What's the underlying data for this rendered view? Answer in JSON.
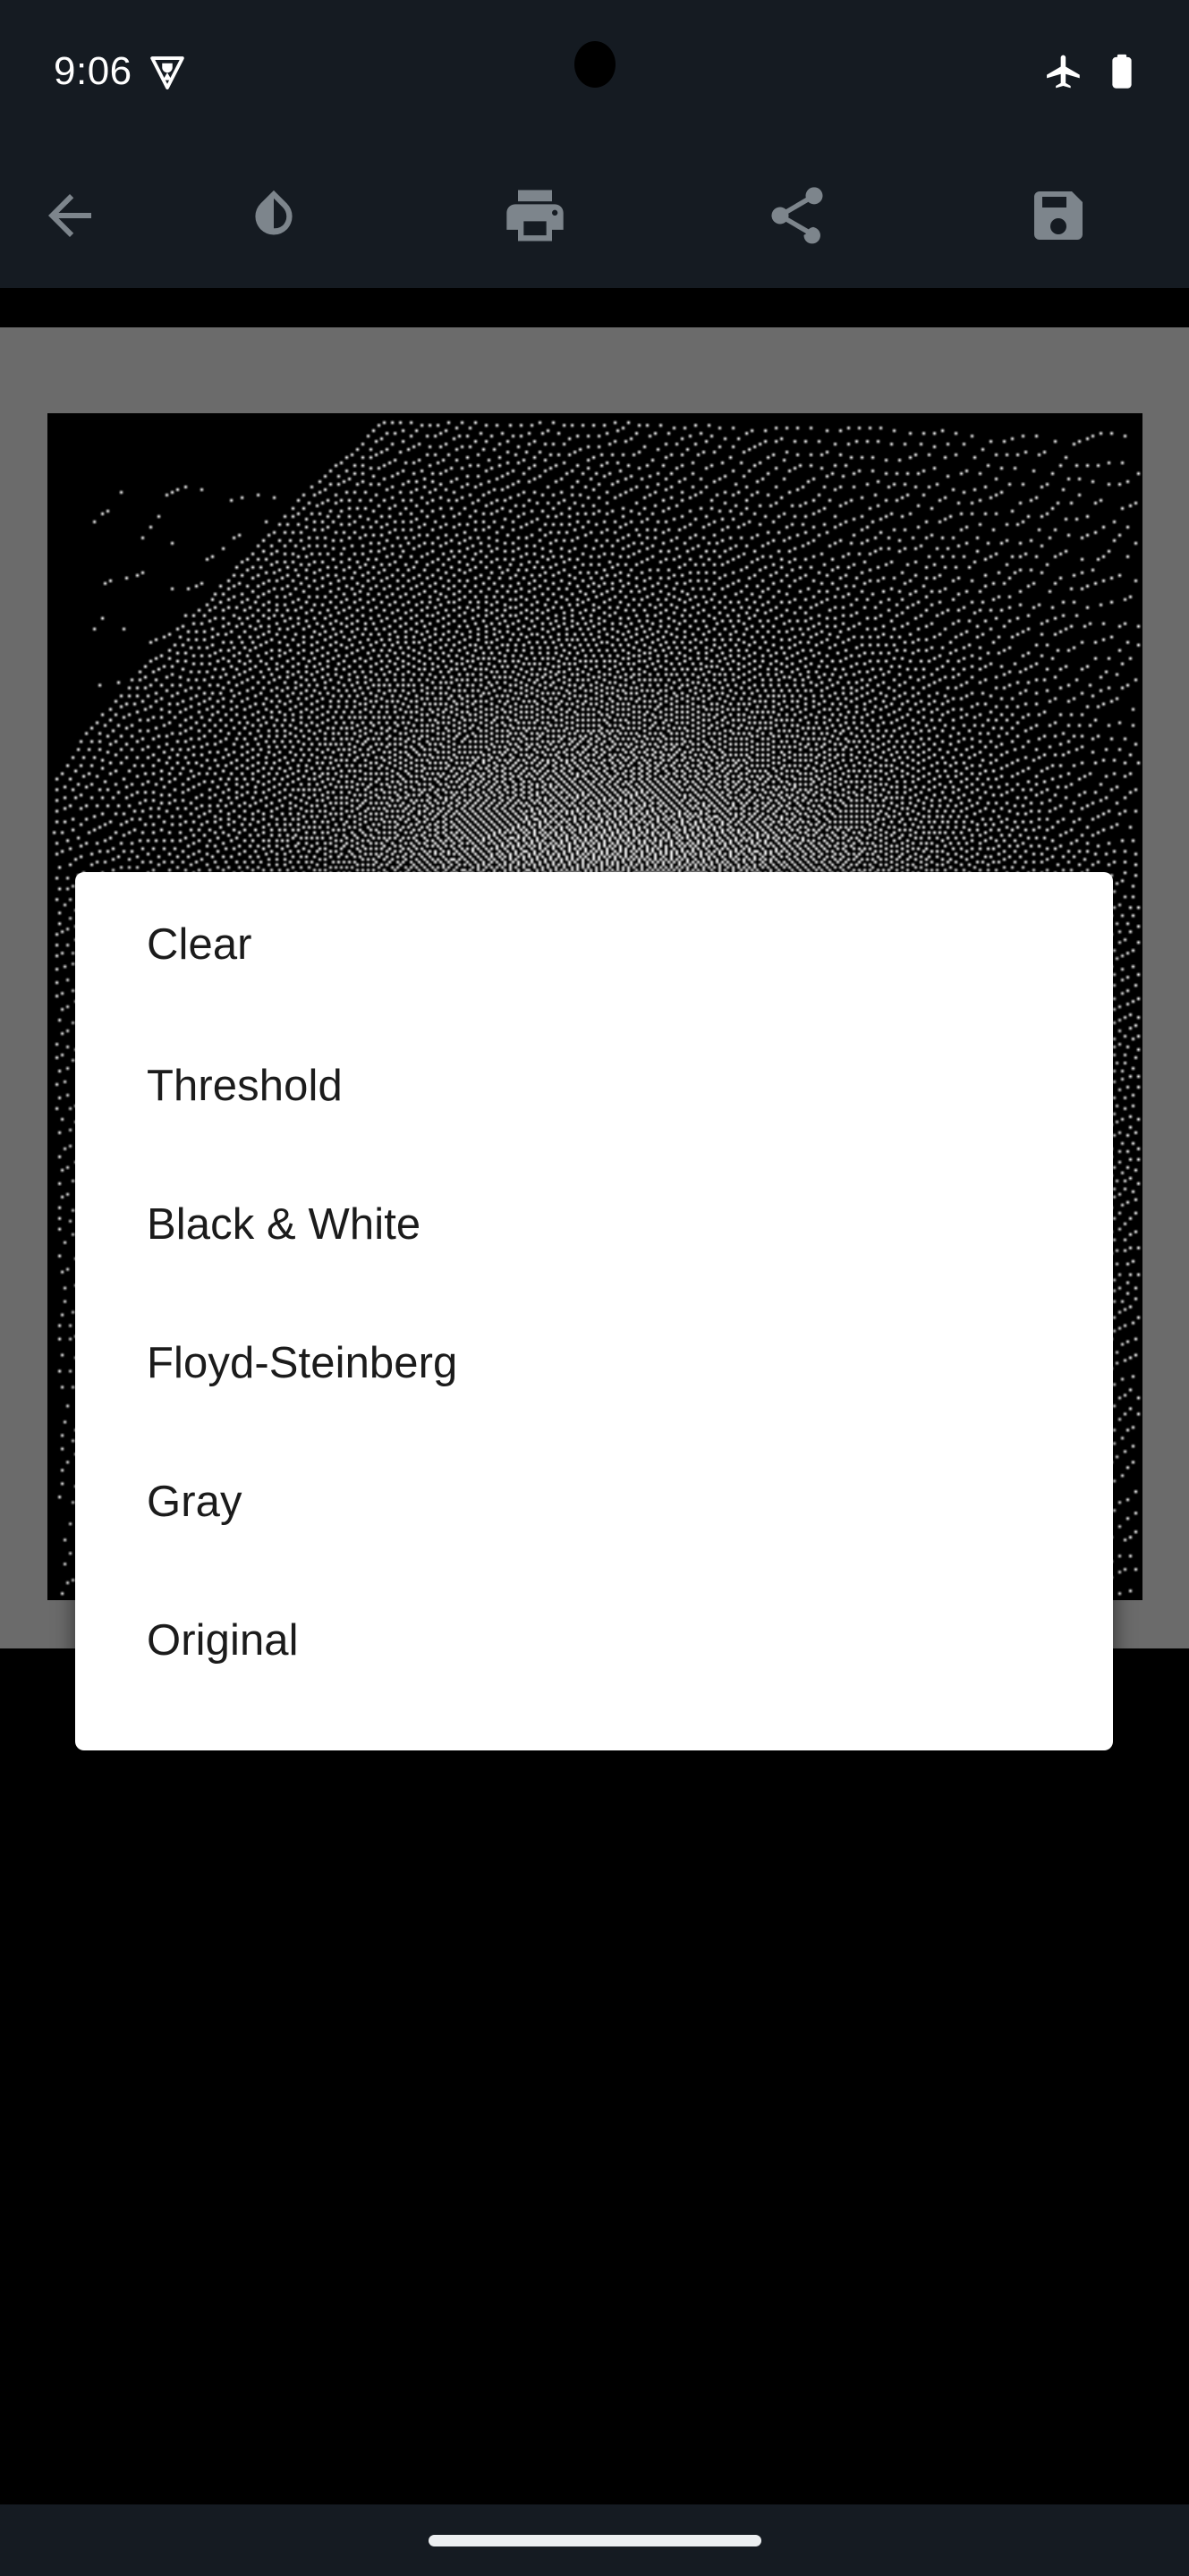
{
  "status_bar": {
    "time": "9:06",
    "icons": [
      {
        "name": "app-notification-icon",
        "glyph": "shield-badge"
      },
      {
        "name": "airplane-mode-icon",
        "glyph": "airplane"
      },
      {
        "name": "battery-icon",
        "glyph": "battery-full"
      }
    ],
    "camera_hole": "front-camera-cutout"
  },
  "toolbar": {
    "background_color": "#151b22",
    "icon_color": "#7d858c",
    "buttons": [
      {
        "name": "back-button",
        "icon": "arrow-left-icon",
        "label": "Back"
      },
      {
        "name": "invert-button",
        "icon": "contrast-droplet-icon",
        "label": "Invert colors"
      },
      {
        "name": "print-button",
        "icon": "printer-icon",
        "label": "Print"
      },
      {
        "name": "share-button",
        "icon": "share-icon",
        "label": "Share"
      },
      {
        "name": "save-button",
        "icon": "floppy-disk-icon",
        "label": "Save"
      }
    ]
  },
  "canvas": {
    "scrim_color": "#6b6b6b",
    "background_color": "#000000",
    "image_description": "Floyd-Steinberg dithered black and white photograph"
  },
  "dialog": {
    "background_color": "#ffffff",
    "text_color": "#1b1b1b",
    "items": [
      {
        "label": "Clear",
        "name": "dialog-item-clear"
      },
      {
        "label": "Threshold",
        "name": "dialog-item-threshold"
      },
      {
        "label": "Black & White",
        "name": "dialog-item-black-and-white"
      },
      {
        "label": "Floyd-Steinberg",
        "name": "dialog-item-floyd-steinberg"
      },
      {
        "label": "Gray",
        "name": "dialog-item-gray"
      },
      {
        "label": "Original",
        "name": "dialog-item-original"
      }
    ]
  },
  "nav_bar": {
    "gesture_pill": "home-gesture-pill",
    "background_color": "#151b22",
    "pill_color": "#eceff1"
  }
}
